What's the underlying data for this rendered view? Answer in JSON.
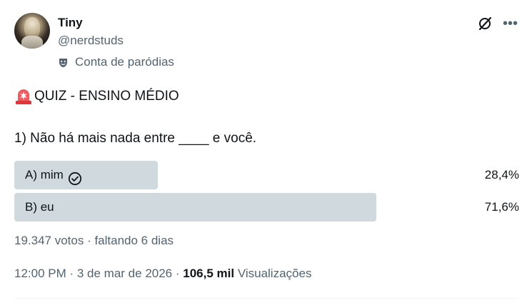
{
  "author": {
    "name": "Tiny",
    "handle": "@nerdstuds",
    "parody_label": "Conta de paródias",
    "parody_icon": "theater-mask-icon"
  },
  "header_icons": {
    "grok": "grok-icon",
    "more": "more-icon"
  },
  "post": {
    "title": "QUIZ - ENSINO MÉDIO",
    "title_icon": "siren-emoji-icon",
    "question": "1) Não há mais nada entre ____ e você."
  },
  "poll": {
    "options": [
      {
        "label": "A) mim",
        "percent_text": "28,4%",
        "percent": 28.4,
        "selected": true
      },
      {
        "label": "B) eu",
        "percent_text": "71,6%",
        "percent": 71.6,
        "selected": false
      }
    ],
    "summary": "19.347 votos · faltando 6 dias"
  },
  "meta": {
    "time_date": "12:00 PM · 3 de mar de 2026 · ",
    "views_count": "106,5 mil",
    "views_label": "Visualizações"
  },
  "colors": {
    "bar": "#cfd9de",
    "secondary_text": "#536471",
    "primary_text": "#0f1419"
  }
}
